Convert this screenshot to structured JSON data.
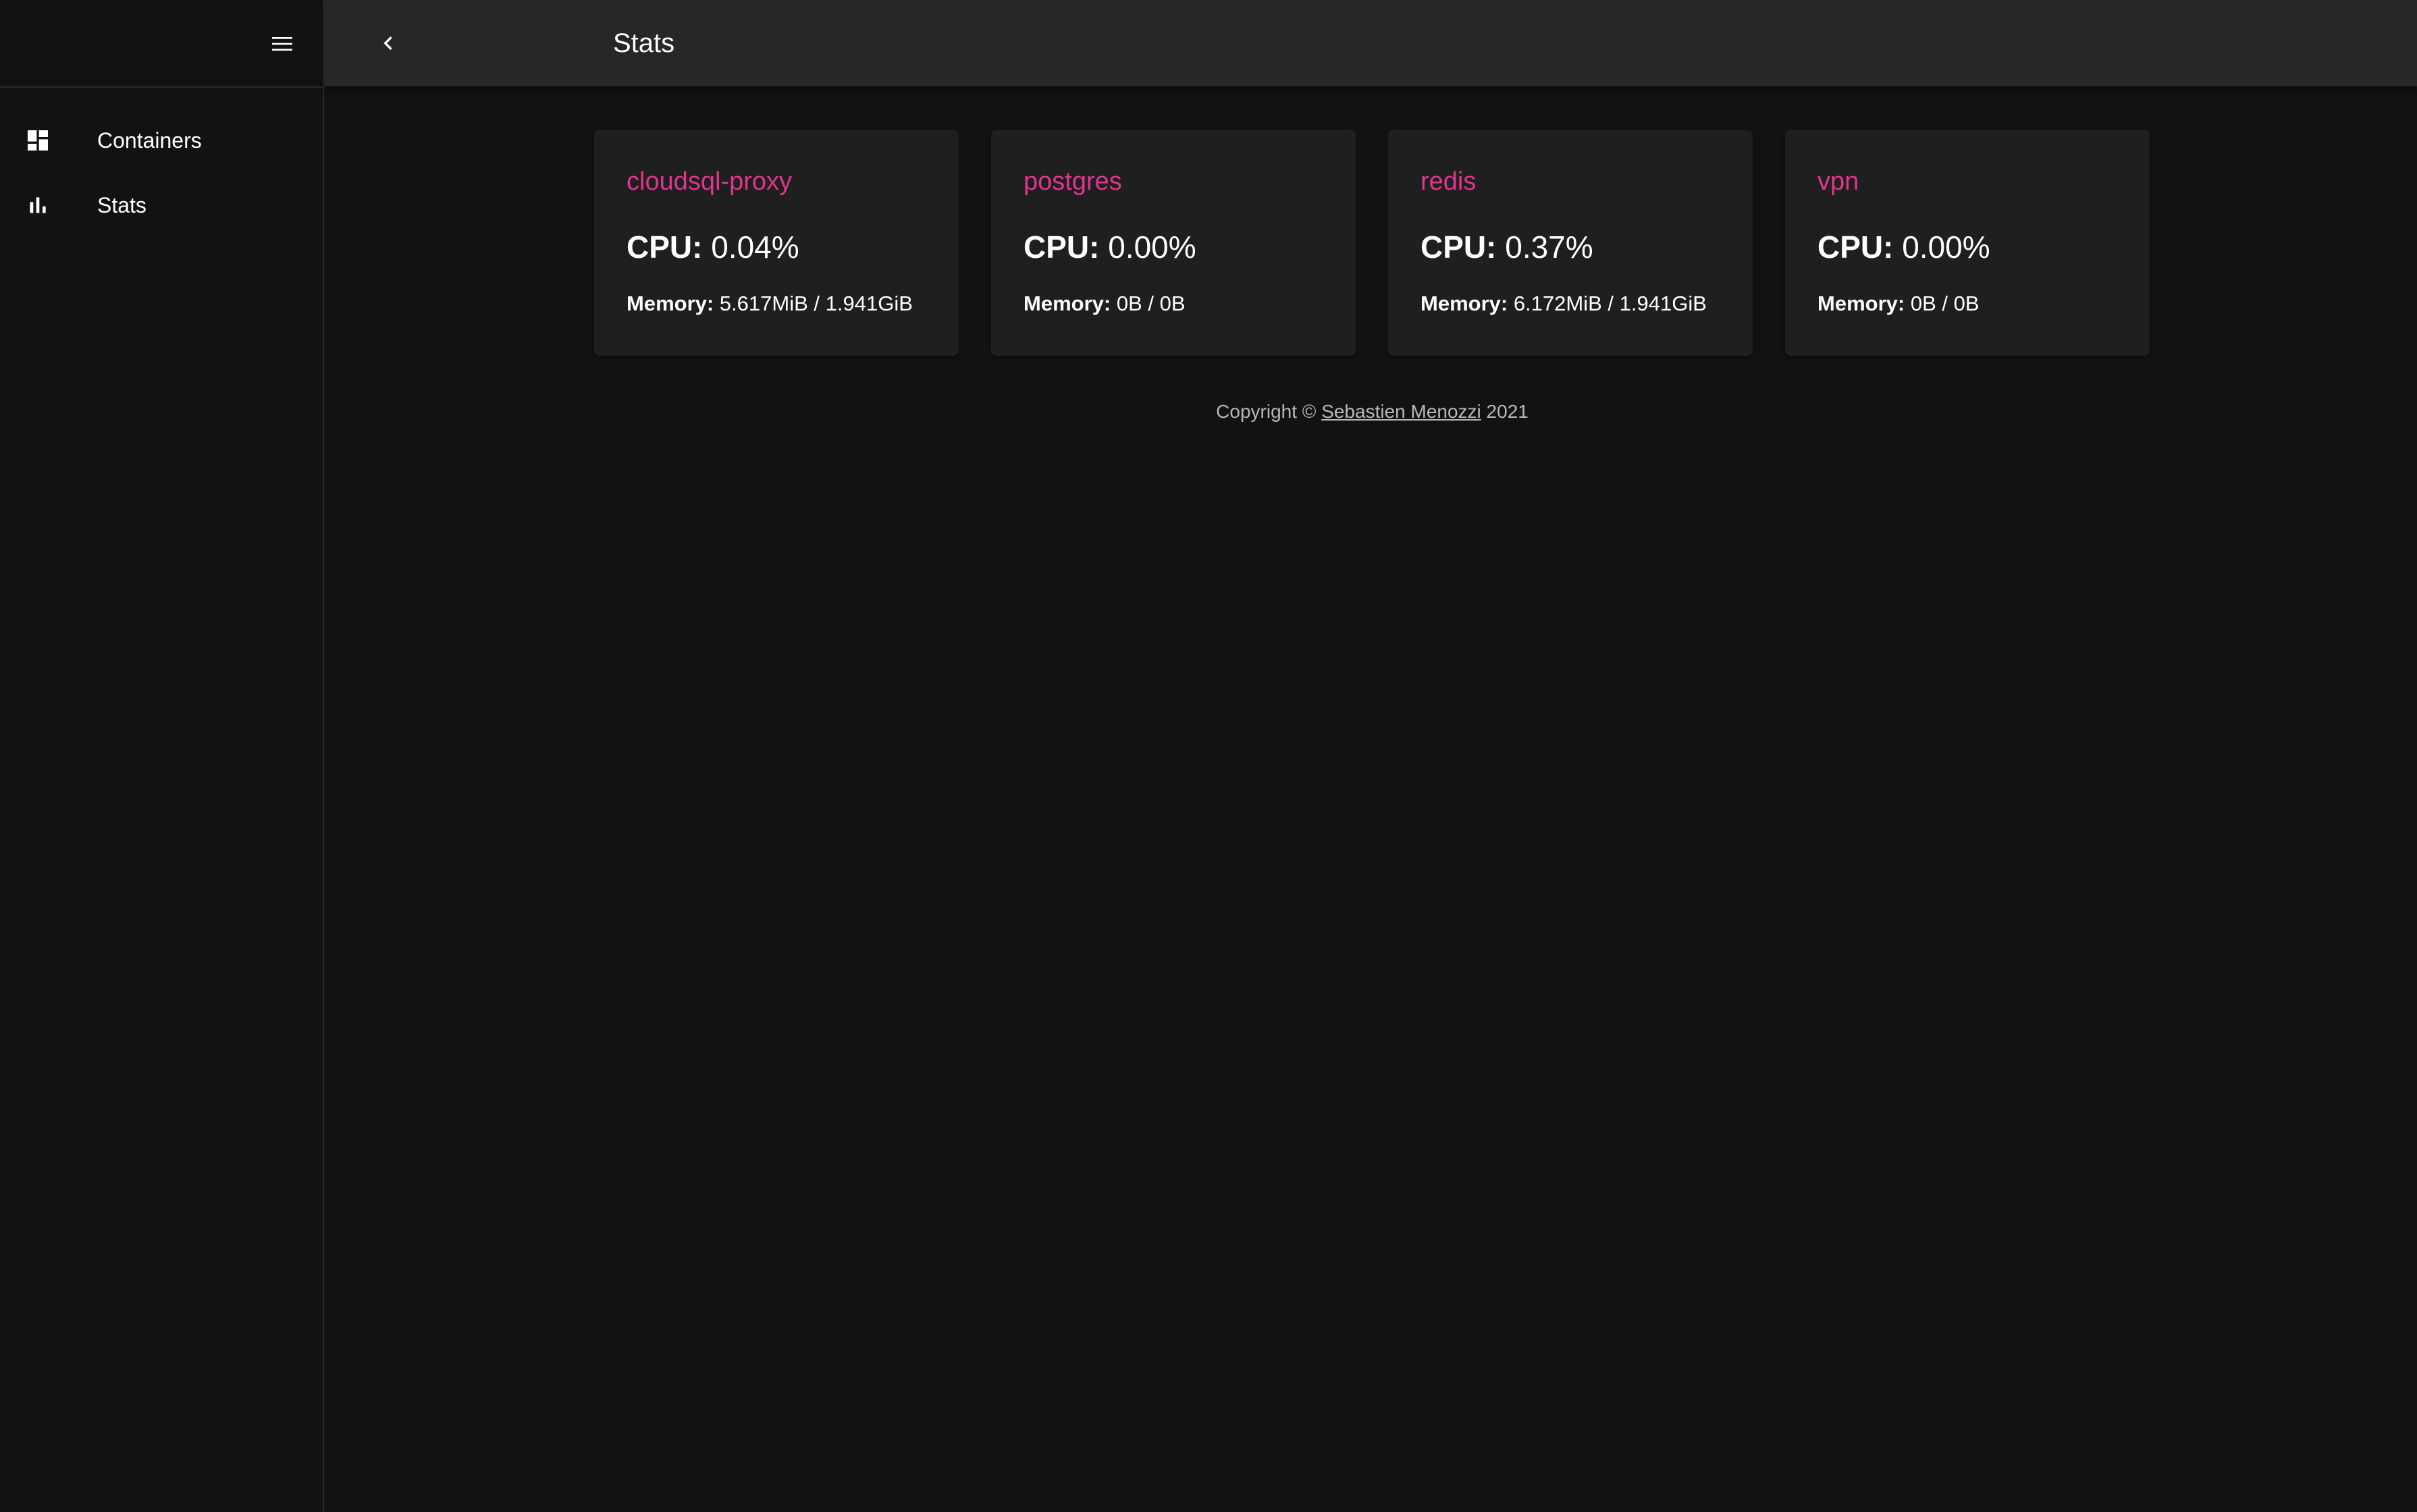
{
  "topbar": {
    "title": "Stats"
  },
  "sidebar": {
    "items": [
      {
        "label": "Containers",
        "icon": "dashboard-icon"
      },
      {
        "label": "Stats",
        "icon": "bar-chart-icon"
      }
    ]
  },
  "containers": [
    {
      "name": "cloudsql-proxy",
      "cpu_label": "CPU:",
      "cpu": "0.04%",
      "memory_label": "Memory:",
      "memory": "5.617MiB / 1.941GiB"
    },
    {
      "name": "postgres",
      "cpu_label": "CPU:",
      "cpu": "0.00%",
      "memory_label": "Memory:",
      "memory": "0B / 0B"
    },
    {
      "name": "redis",
      "cpu_label": "CPU:",
      "cpu": "0.37%",
      "memory_label": "Memory:",
      "memory": "6.172MiB / 1.941GiB"
    },
    {
      "name": "vpn",
      "cpu_label": "CPU:",
      "cpu": "0.00%",
      "memory_label": "Memory:",
      "memory": "0B / 0B"
    }
  ],
  "footer": {
    "prefix": "Copyright ©",
    "author": "Sebastien Menozzi",
    "year": "2021"
  },
  "colors": {
    "accent": "#e0358e",
    "background": "#121212",
    "appbar": "#272727",
    "card": "#1f1f1f"
  }
}
